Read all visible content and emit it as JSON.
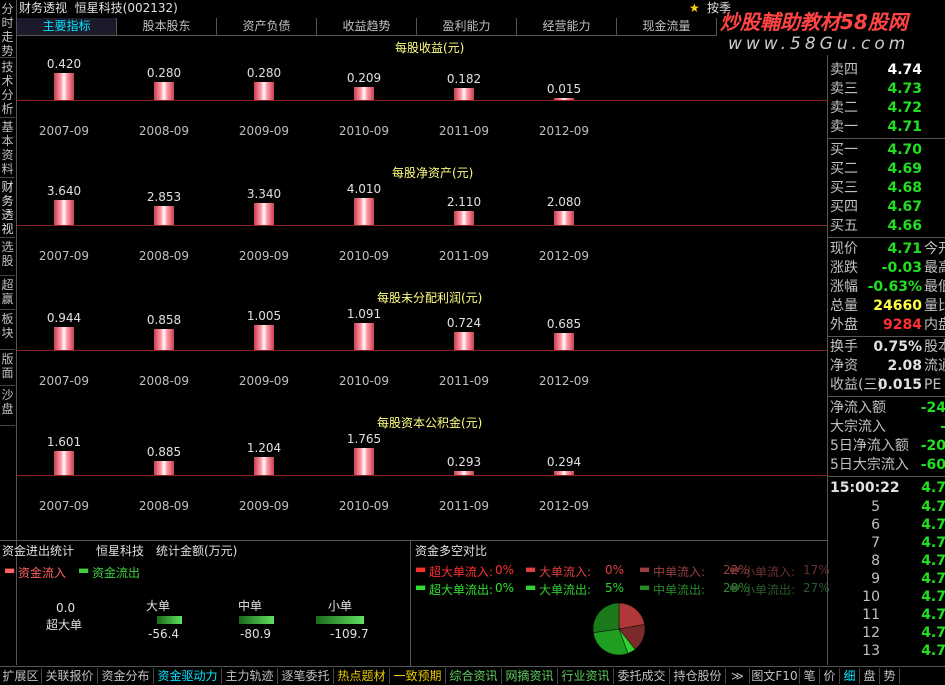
{
  "left_tabs": [
    "分时走势",
    "技术分析",
    "基本资料",
    "财务透视",
    "选股",
    "超赢",
    "板块",
    "版面",
    "沙盘"
  ],
  "title": {
    "app": "财务透视",
    "stock": "恒星科技(002132)",
    "toggle": "按季"
  },
  "watermark": {
    "main": "炒股輔助教材58股网",
    "url": "www.58Gu.com"
  },
  "tabs": [
    "主要指标",
    "股本股东",
    "资产负债",
    "收益趋势",
    "盈利能力",
    "经营能力",
    "现金流量"
  ],
  "charts": [
    {
      "title": "每股收益(元)",
      "categories": [
        "2007-09",
        "2008-09",
        "2009-09",
        "2010-09",
        "2011-09",
        "2012-09"
      ],
      "values": [
        0.42,
        0.28,
        0.28,
        0.209,
        0.182,
        0.015
      ],
      "labels": [
        "0.420",
        "0.280",
        "0.280",
        "0.209",
        "0.182",
        "0.015"
      ]
    },
    {
      "title": "每股净资产(元)",
      "categories": [
        "2007-09",
        "2008-09",
        "2009-09",
        "2010-09",
        "2011-09",
        "2012-09"
      ],
      "values": [
        3.64,
        2.853,
        3.34,
        4.01,
        2.11,
        2.08
      ],
      "labels": [
        "3.640",
        "2.853",
        "3.340",
        "4.010",
        "2.110",
        "2.080"
      ]
    },
    {
      "title": "每股未分配利润(元)",
      "categories": [
        "2007-09",
        "2008-09",
        "2009-09",
        "2010-09",
        "2011-09",
        "2012-09"
      ],
      "values": [
        0.944,
        0.858,
        1.005,
        1.091,
        0.724,
        0.685
      ],
      "labels": [
        "0.944",
        "0.858",
        "1.005",
        "1.091",
        "0.724",
        "0.685"
      ]
    },
    {
      "title": "每股资本公积金(元)",
      "categories": [
        "2007-09",
        "2008-09",
        "2009-09",
        "2010-09",
        "2011-09",
        "2012-09"
      ],
      "values": [
        1.601,
        0.885,
        1.204,
        1.765,
        0.293,
        0.294
      ],
      "labels": [
        "1.601",
        "0.885",
        "1.204",
        "1.765",
        "0.293",
        "0.294"
      ]
    }
  ],
  "flow": {
    "header": [
      "资金进出统计",
      "恒星科技",
      "统计金额(万元)"
    ],
    "legend_in": "资金流入",
    "legend_out": "资金流出",
    "items": [
      {
        "label": "超大单",
        "value": "0.0"
      },
      {
        "label": "大单",
        "value": "-56.4"
      },
      {
        "label": "中单",
        "value": "-80.9"
      },
      {
        "label": "小单",
        "value": "-109.7"
      }
    ]
  },
  "compare": {
    "header": "资金多空对比",
    "inflow": [
      {
        "label": "超大单流入:",
        "pct": "0%"
      },
      {
        "label": "大单流入:",
        "pct": "0%"
      },
      {
        "label": "中单流入:",
        "pct": "22%"
      },
      {
        "label": "小单流入:",
        "pct": "17%"
      }
    ],
    "outflow": [
      {
        "label": "超大单流出:",
        "pct": "0%"
      },
      {
        "label": "大单流出:",
        "pct": "5%"
      },
      {
        "label": "中单流出:",
        "pct": "28%"
      },
      {
        "label": "小单流出:",
        "pct": "27%"
      }
    ],
    "colors": [
      "#ff2020",
      "#e04040",
      "#803030",
      "#502020",
      "#20c020",
      "#30d030",
      "#207020",
      "#204020"
    ]
  },
  "quotes": {
    "sell": [
      {
        "label": "卖四",
        "price": "4.74"
      },
      {
        "label": "卖三",
        "price": "4.73"
      },
      {
        "label": "卖二",
        "price": "4.72"
      },
      {
        "label": "卖一",
        "price": "4.71"
      }
    ],
    "buy": [
      {
        "label": "买一",
        "price": "4.70"
      },
      {
        "label": "买二",
        "price": "4.69"
      },
      {
        "label": "买三",
        "price": "4.68"
      },
      {
        "label": "买四",
        "price": "4.67"
      },
      {
        "label": "买五",
        "price": "4.66"
      }
    ],
    "stats": [
      {
        "label": "现价",
        "value": "4.71",
        "tail": "今开",
        "color": "#20e020"
      },
      {
        "label": "涨跌",
        "value": "-0.03",
        "tail": "最高",
        "color": "#20e020"
      },
      {
        "label": "涨幅",
        "value": "-0.63%",
        "tail": "最低",
        "color": "#20e020"
      },
      {
        "label": "总量",
        "value": "24660",
        "tail": "量比",
        "color": "#ffff40"
      },
      {
        "label": "外盘",
        "value": "9284",
        "tail": "内盘",
        "color": "#ff3030"
      },
      {
        "label": "换手",
        "value": "0.75%",
        "tail": "股本",
        "color": "#e0e0e0"
      },
      {
        "label": "净资",
        "value": "2.08",
        "tail": "流通",
        "color": "#e0e0e0"
      },
      {
        "label": "收益(三)",
        "value": "0.015",
        "tail": "PE",
        "color": "#e0e0e0"
      }
    ],
    "flows": [
      {
        "label": "净流入额",
        "value": "-24"
      },
      {
        "label": "大宗流入",
        "value": "-"
      },
      {
        "label": "5日净流入额",
        "value": "-20"
      },
      {
        "label": "5日大宗流入",
        "value": "-60"
      }
    ],
    "ticks_time": "15:00:22",
    "ticks": [
      {
        "n": "",
        "p": "4.7"
      },
      {
        "n": "5",
        "p": "4.7"
      },
      {
        "n": "6",
        "p": "4.7"
      },
      {
        "n": "7",
        "p": "4.7"
      },
      {
        "n": "8",
        "p": "4.7"
      },
      {
        "n": "9",
        "p": "4.7"
      },
      {
        "n": "10",
        "p": "4.7"
      },
      {
        "n": "11",
        "p": "4.7"
      },
      {
        "n": "12",
        "p": "4.7"
      },
      {
        "n": "13",
        "p": "4.7"
      }
    ]
  },
  "toolbar": [
    "扩展区",
    "关联报价",
    "资金分布",
    "资金驱动力",
    "主力轨迹",
    "逐笔委托",
    "热点题材",
    "一致预期",
    "综合资讯",
    "网摘资讯",
    "行业资讯",
    "委托成交",
    "持仓股份",
    "≫",
    "图文F10",
    "笔",
    "价",
    "细",
    "盘",
    "势"
  ]
}
